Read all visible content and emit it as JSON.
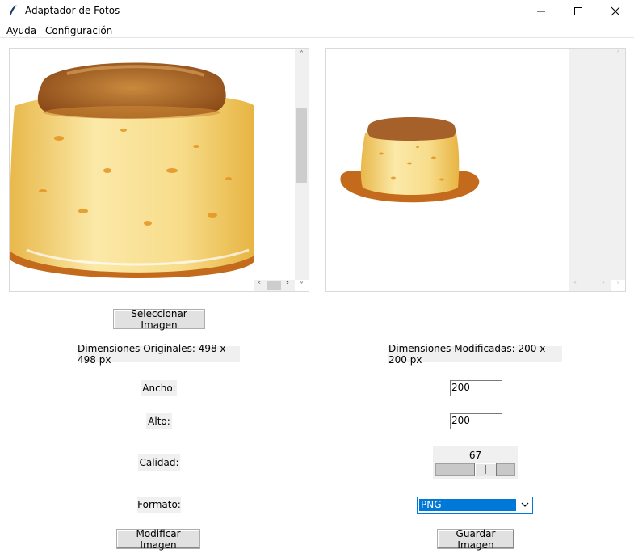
{
  "window": {
    "title": "Adaptador de Fotos"
  },
  "menu": {
    "items": [
      "Ayuda",
      "Configuración"
    ]
  },
  "buttons": {
    "select_image": "Seleccionar Imagen",
    "modify_image": "Modificar Imagen",
    "save_image": "Guardar Imagen"
  },
  "dimensions": {
    "original": "Dimensiones Originales: 498 x 498 px",
    "modified": "Dimensiones Modificadas: 200 x 200 px"
  },
  "form": {
    "width_label": "Ancho:",
    "width_value": "200",
    "height_label": "Alto:",
    "height_value": "200",
    "quality_label": "Calidad:",
    "quality_value": "67",
    "quality_fraction": 0.67,
    "format_label": "Formato:",
    "format_value": "PNG"
  },
  "colors": {
    "accent": "#0078d7",
    "caramel": "#b8661e",
    "custard": "#f5d98a"
  },
  "icons": {
    "app": "feather-icon",
    "minimize": "minimize-icon",
    "maximize": "maximize-icon",
    "close": "close-icon",
    "dropdown": "chevron-down-icon"
  }
}
